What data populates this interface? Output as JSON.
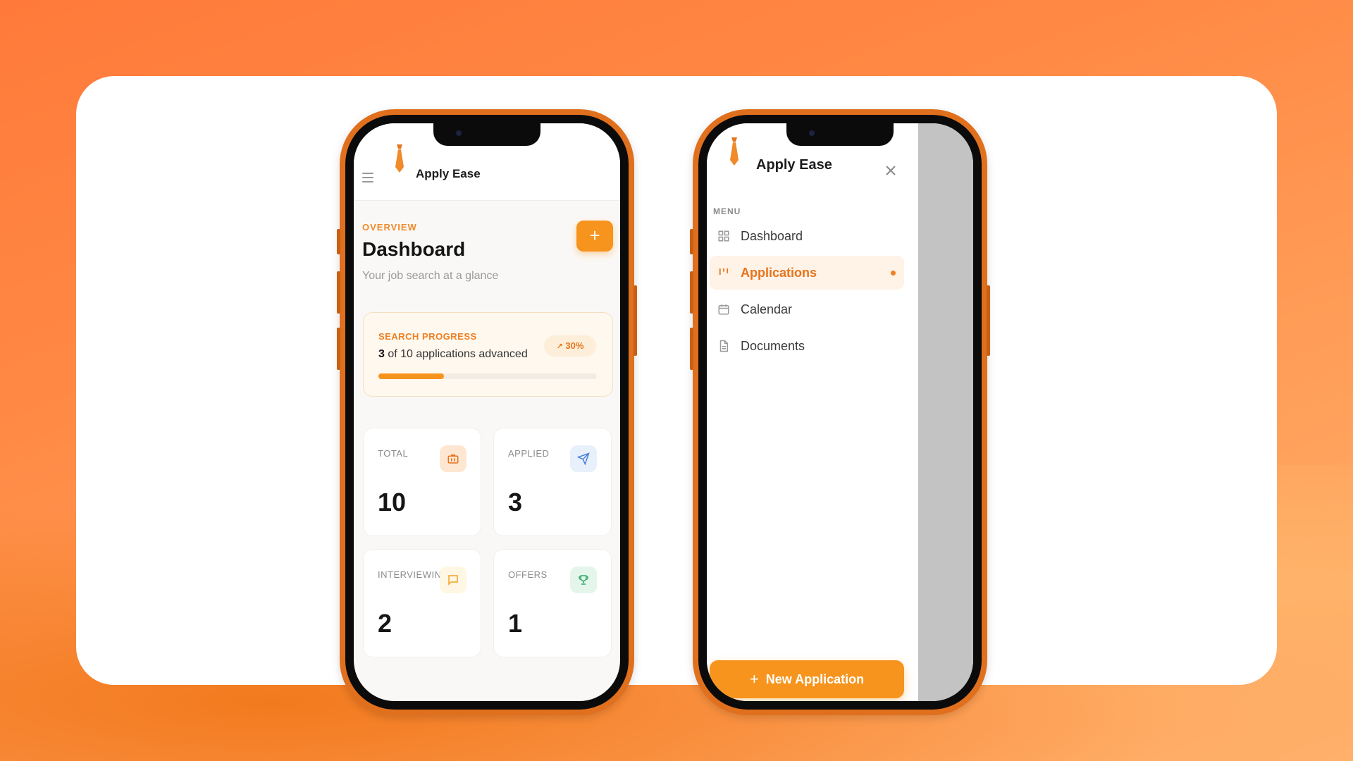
{
  "app": {
    "name": "Apply Ease",
    "logo_caption": "Apply Ease"
  },
  "colors": {
    "accent": "#f7941d",
    "accent_dark": "#e6741c",
    "background": "#ff8a45"
  },
  "dashboard": {
    "eyebrow": "OVERVIEW",
    "title": "Dashboard",
    "subtitle": "Your job search at a glance",
    "add_button_label": "+",
    "progress": {
      "eyebrow": "SEARCH PROGRESS",
      "advanced": "3",
      "text_suffix": " of 10 applications advanced",
      "badge": "30%",
      "fraction": 0.3
    },
    "stats": [
      {
        "label": "TOTAL",
        "value": "10",
        "icon": "briefcase-icon"
      },
      {
        "label": "APPLIED",
        "value": "3",
        "icon": "send-icon"
      },
      {
        "label": "INTERVIEWING",
        "value": "2",
        "icon": "chat-icon"
      },
      {
        "label": "OFFERS",
        "value": "1",
        "icon": "trophy-icon"
      }
    ]
  },
  "drawer": {
    "menu_label": "MENU",
    "items": [
      {
        "label": "Dashboard",
        "icon": "grid-icon",
        "active": false
      },
      {
        "label": "Applications",
        "icon": "kanban-icon",
        "active": true
      },
      {
        "label": "Calendar",
        "icon": "calendar-icon",
        "active": false
      },
      {
        "label": "Documents",
        "icon": "document-icon",
        "active": false
      }
    ],
    "new_application_label": "New Application"
  }
}
